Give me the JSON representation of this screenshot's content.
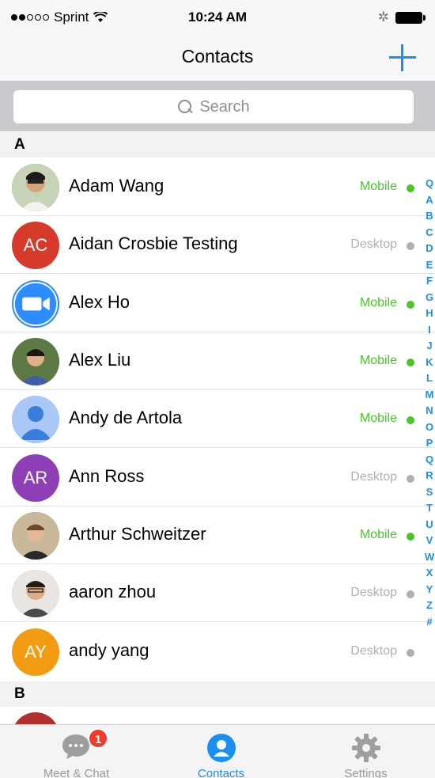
{
  "status_bar": {
    "carrier": "Sprint",
    "time": "10:24 AM",
    "bluetooth": "✲"
  },
  "nav": {
    "title": "Contacts",
    "add_icon": "plus-icon"
  },
  "search": {
    "placeholder": "Search"
  },
  "sections": [
    {
      "letter": "A"
    },
    {
      "letter": "B"
    }
  ],
  "contacts": [
    {
      "name": "Adam Wang",
      "status": "Mobile",
      "avatar_type": "photo",
      "initials": "",
      "color": "#6a7d5a"
    },
    {
      "name": "Aidan Crosbie Testing",
      "status": "Desktop",
      "avatar_type": "initials",
      "initials": "AC",
      "color": "#d63a2b"
    },
    {
      "name": "Alex Ho",
      "status": "Mobile",
      "avatar_type": "zoom-logo",
      "initials": "",
      "color": "#2d8cff"
    },
    {
      "name": "Alex Liu",
      "status": "Mobile",
      "avatar_type": "photo",
      "initials": "",
      "color": "#4f6a3a"
    },
    {
      "name": "Andy de Artola",
      "status": "Mobile",
      "avatar_type": "default-person",
      "initials": "",
      "color": "#a9c8f5"
    },
    {
      "name": "Ann Ross",
      "status": "Desktop",
      "avatar_type": "initials",
      "initials": "AR",
      "color": "#8e3fb5"
    },
    {
      "name": "Arthur Schweitzer",
      "status": "Mobile",
      "avatar_type": "photo",
      "initials": "",
      "color": "#8a7a5c"
    },
    {
      "name": "aaron zhou",
      "status": "Desktop",
      "avatar_type": "photo",
      "initials": "",
      "color": "#9a8a78"
    },
    {
      "name": "andy yang",
      "status": "Desktop",
      "avatar_type": "initials",
      "initials": "AY",
      "color": "#f39c12"
    }
  ],
  "alpha_index": [
    "Q",
    "A",
    "B",
    "C",
    "D",
    "E",
    "F",
    "G",
    "H",
    "I",
    "J",
    "K",
    "L",
    "M",
    "N",
    "O",
    "P",
    "Q",
    "R",
    "S",
    "T",
    "U",
    "V",
    "W",
    "X",
    "Y",
    "Z",
    "#"
  ],
  "tabs": [
    {
      "label": "Meet & Chat",
      "icon": "chat-bubble-icon",
      "badge": "1",
      "active": false
    },
    {
      "label": "Contacts",
      "icon": "contact-person-icon",
      "badge": "",
      "active": true
    },
    {
      "label": "Settings",
      "icon": "gear-icon",
      "badge": "",
      "active": false
    }
  ],
  "colors": {
    "accent": "#1a8ff0",
    "mobile_status": "#4cc52c",
    "desktop_status": "#b0b0b0",
    "badge": "#f03a2b"
  }
}
